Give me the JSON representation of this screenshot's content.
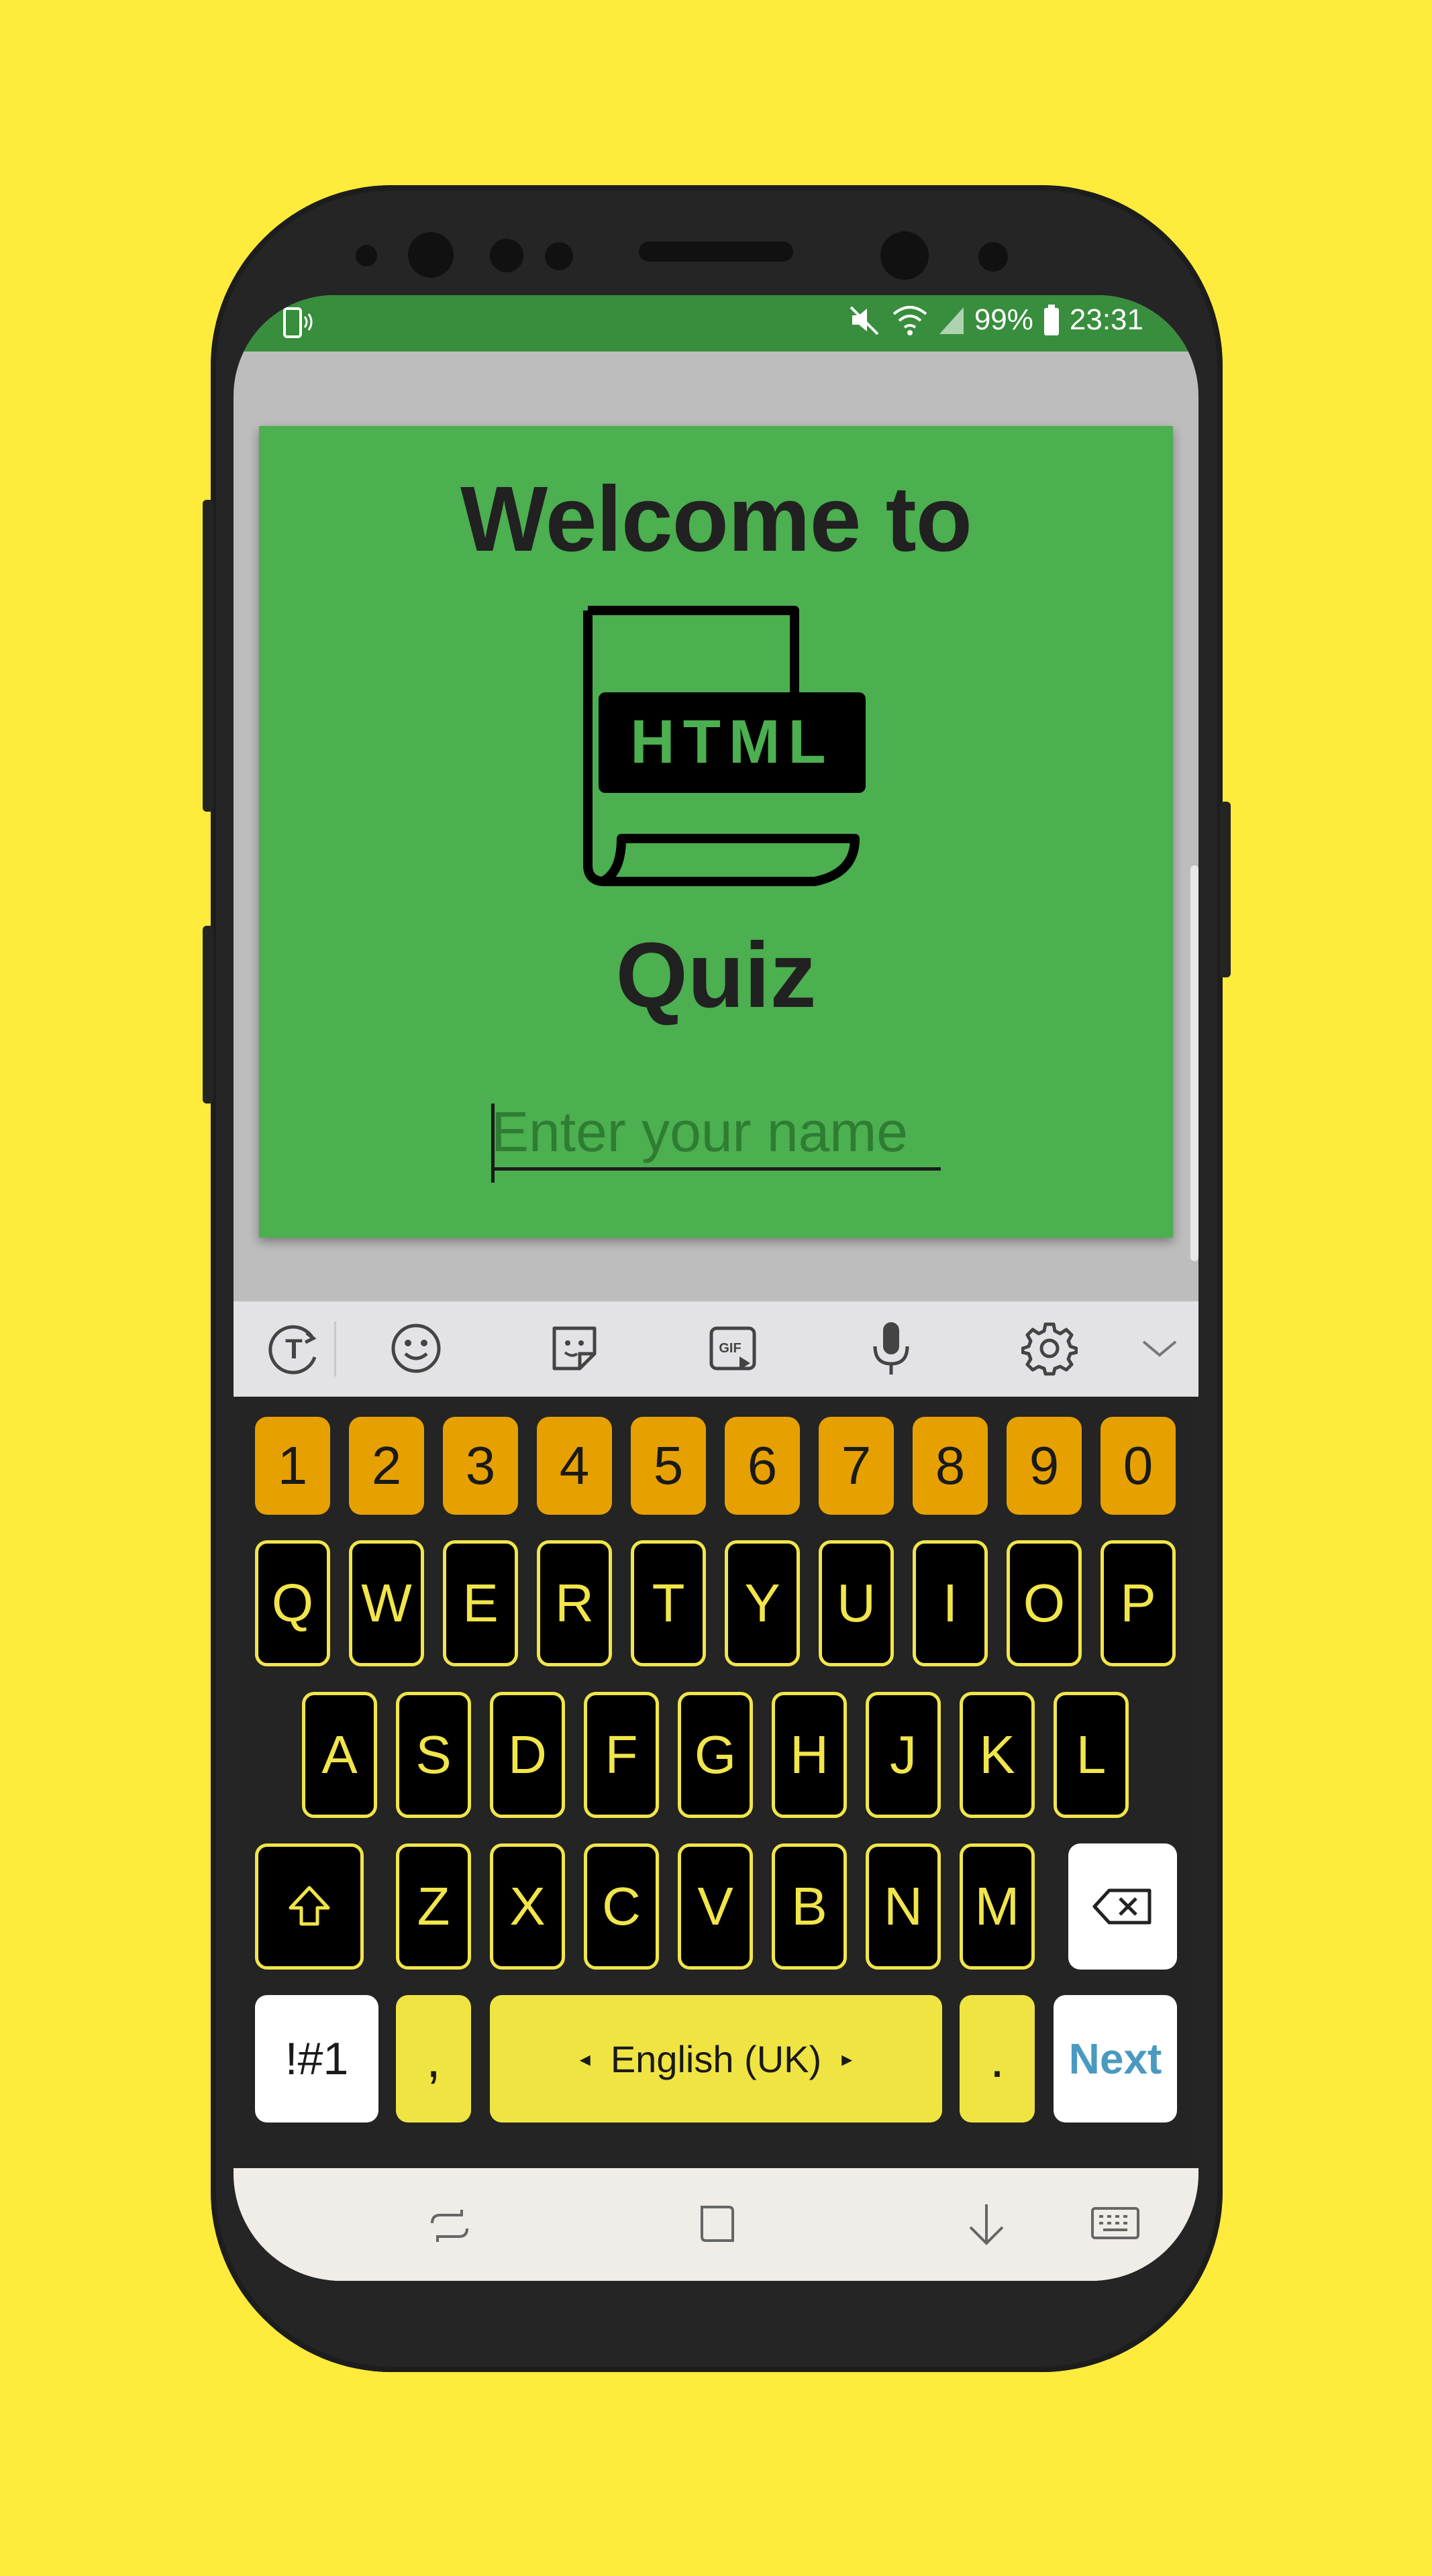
{
  "status_bar": {
    "battery": "99%",
    "time": "23:31",
    "icons": [
      "vibrate-mode-icon",
      "mute-icon",
      "wifi-icon",
      "signal-icon",
      "battery-icon"
    ]
  },
  "app": {
    "welcome_text": "Welcome to",
    "logo_text": "HTML",
    "quiz_text": "Quiz",
    "name_placeholder": "Enter your name",
    "colors": {
      "card": "#4CAF50",
      "status": "#388E3C",
      "background": "#FFEB3B"
    }
  },
  "keyboard": {
    "toolbar_icons": [
      "text-style-icon",
      "emoji-icon",
      "sticker-icon",
      "gif-icon",
      "microphone-icon",
      "settings-icon",
      "collapse-chevron-icon"
    ],
    "gif_label": "GIF",
    "number_row": [
      "1",
      "2",
      "3",
      "4",
      "5",
      "6",
      "7",
      "8",
      "9",
      "0"
    ],
    "row1": [
      "Q",
      "W",
      "E",
      "R",
      "T",
      "Y",
      "U",
      "I",
      "O",
      "P"
    ],
    "row2": [
      "A",
      "S",
      "D",
      "F",
      "G",
      "H",
      "J",
      "K",
      "L"
    ],
    "row3": [
      "Z",
      "X",
      "C",
      "V",
      "B",
      "N",
      "M"
    ],
    "symbols_label": "!#1",
    "comma_label": ",",
    "space_label": "English (UK)",
    "period_label": ".",
    "next_label": "Next",
    "colors": {
      "number_keys": "#E6A100",
      "letter_border": "#F1E54A",
      "next_text": "#4A9AC0"
    }
  },
  "navbar": {
    "icons": [
      "recents-icon",
      "home-icon",
      "back-icon",
      "keyboard-switch-icon"
    ]
  }
}
